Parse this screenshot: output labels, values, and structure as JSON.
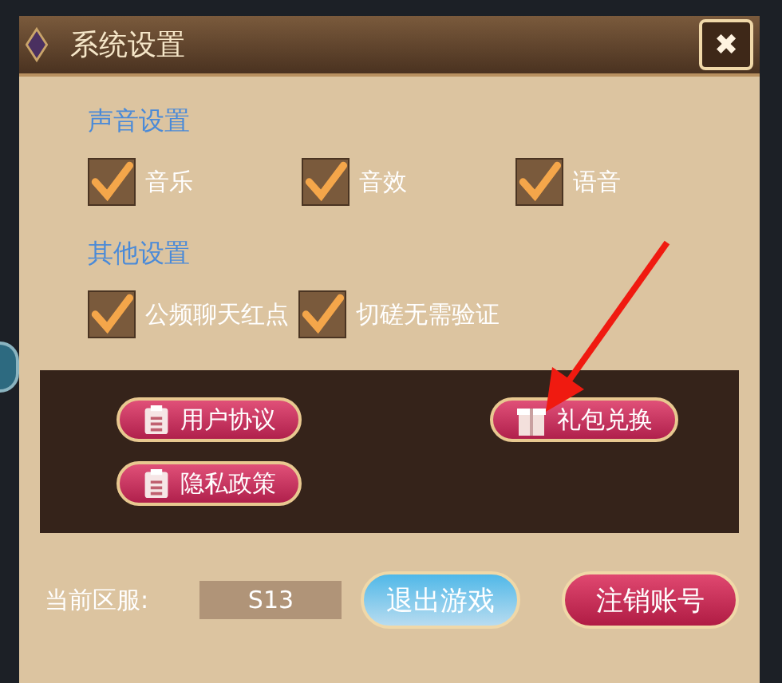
{
  "window": {
    "title": "系统设置",
    "close": "✖"
  },
  "sections": [
    {
      "title": "声音设置",
      "options": [
        {
          "label": "音乐",
          "checked": true
        },
        {
          "label": "音效",
          "checked": true
        },
        {
          "label": "语音",
          "checked": true
        }
      ]
    },
    {
      "title": "其他设置",
      "options": [
        {
          "label": "公频聊天红点",
          "checked": true
        },
        {
          "label": "切磋无需验证",
          "checked": true
        }
      ]
    }
  ],
  "links": [
    {
      "label": "用户协议",
      "kind": "document"
    },
    {
      "label": "礼包兑换",
      "kind": "gift"
    },
    {
      "label": "隐私政策",
      "kind": "document"
    }
  ],
  "footer": {
    "server_label": "当前区服:",
    "server": "S13",
    "buttons": [
      {
        "label": "退出游戏",
        "kind": "blue"
      },
      {
        "label": "注销账号",
        "kind": "red"
      }
    ]
  }
}
